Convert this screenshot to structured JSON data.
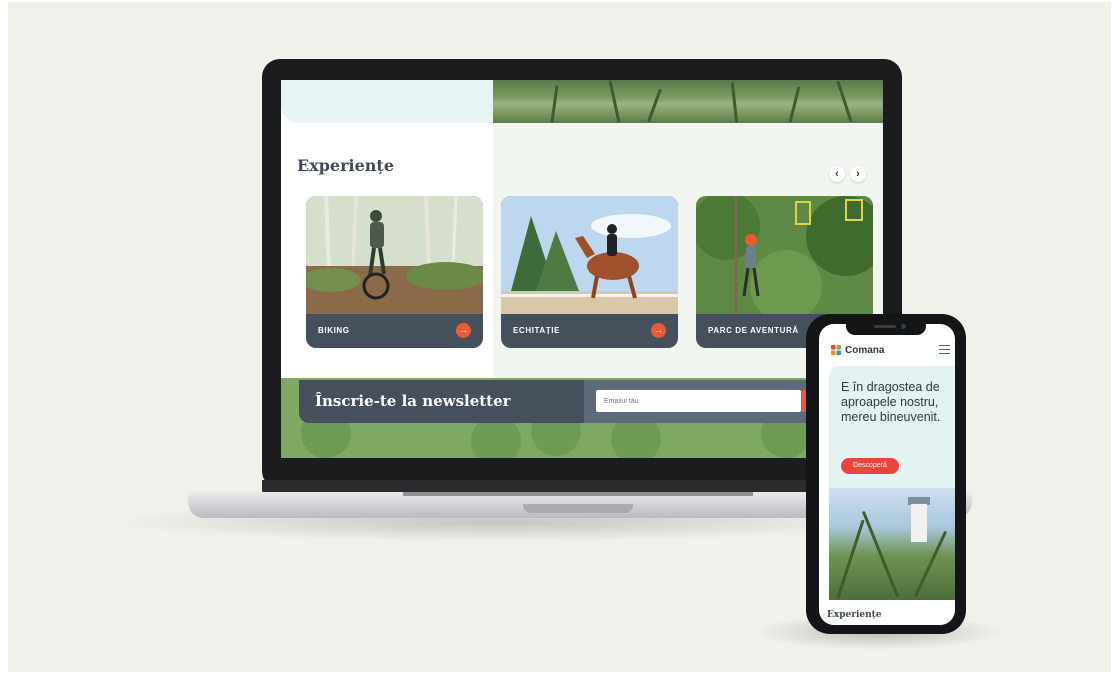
{
  "colors": {
    "accent": "#e85b33",
    "dark_slate": "#45505c",
    "pale_teal": "#e6f4f3",
    "green": "#7fa962",
    "background": "#eef2ea"
  },
  "laptop": {
    "experiences": {
      "title": "Experiențe",
      "prev_icon": "chevron-left-icon",
      "next_icon": "chevron-right-icon",
      "prev_glyph": "‹",
      "next_glyph": "›",
      "cards": [
        {
          "label": "BIKING",
          "action_glyph": "→"
        },
        {
          "label": "ECHITAȚIE",
          "action_glyph": "→"
        },
        {
          "label": "PARC DE AVENTURĂ"
        }
      ]
    },
    "newsletter": {
      "title": "Înscrie-te la newsletter",
      "email_placeholder": "Emailul tău"
    }
  },
  "phone": {
    "brand": "Comana",
    "headline": "E în dragostea de aproapele nostru, mereu bineuvenit.",
    "cta_label": "Descoperă",
    "section_title": "Experiențe"
  }
}
